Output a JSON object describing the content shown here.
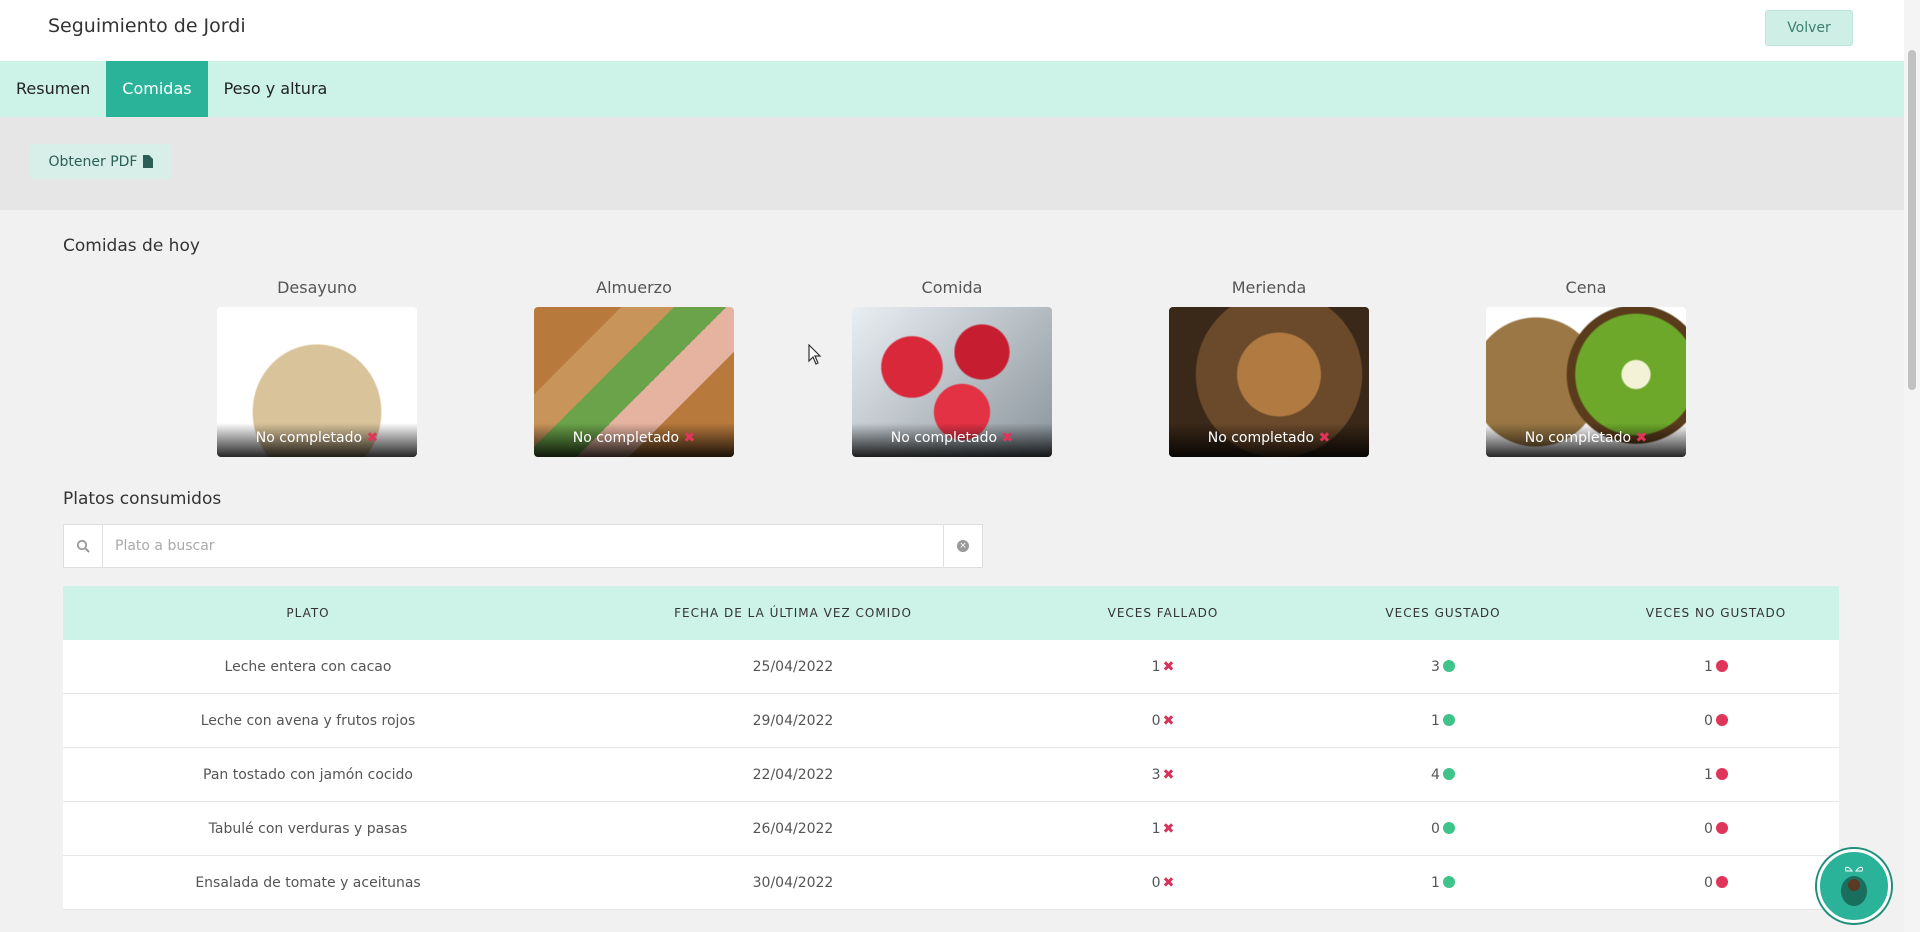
{
  "header": {
    "title": "Seguimiento de Jordi",
    "back_label": "Volver"
  },
  "tabs": [
    {
      "label": "Resumen",
      "active": false
    },
    {
      "label": "Comidas",
      "active": true
    },
    {
      "label": "Peso y altura",
      "active": false
    }
  ],
  "toolbar": {
    "pdf_label": "Obtener PDF",
    "pdf_icon": "file-pdf-icon"
  },
  "today": {
    "title": "Comidas de hoy",
    "meals": [
      {
        "label": "Desayuno",
        "status": "No completado",
        "image": "oats"
      },
      {
        "label": "Almuerzo",
        "status": "No completado",
        "image": "sandwich"
      },
      {
        "label": "Comida",
        "status": "No completado",
        "image": "strawberries"
      },
      {
        "label": "Merienda",
        "status": "No completado",
        "image": "nuts"
      },
      {
        "label": "Cena",
        "status": "No completado",
        "image": "kiwi"
      }
    ]
  },
  "dishes": {
    "title": "Platos consumidos",
    "search_placeholder": "Plato a buscar",
    "search_value": "",
    "columns": [
      "PLATO",
      "FECHA DE LA ÚLTIMA VEZ COMIDO",
      "VECES FALLADO",
      "VECES GUSTADO",
      "VECES NO GUSTADO"
    ],
    "rows": [
      {
        "plato": "Leche entera con cacao",
        "fecha": "25/04/2022",
        "fallado": "1",
        "gustado": "3",
        "no_gustado": "1"
      },
      {
        "plato": "Leche con avena y frutos rojos",
        "fecha": "29/04/2022",
        "fallado": "0",
        "gustado": "1",
        "no_gustado": "0"
      },
      {
        "plato": "Pan tostado con jamón cocido",
        "fecha": "22/04/2022",
        "fallado": "3",
        "gustado": "4",
        "no_gustado": "1"
      },
      {
        "plato": "Tabulé con verduras y pasas",
        "fecha": "26/04/2022",
        "fallado": "1",
        "gustado": "0",
        "no_gustado": "0"
      },
      {
        "plato": "Ensalada de tomate y aceitunas",
        "fecha": "30/04/2022",
        "fallado": "0",
        "gustado": "1",
        "no_gustado": "0"
      }
    ]
  },
  "colors": {
    "accent": "#2bb39a",
    "tab_bg": "#cdf2e8",
    "miss": "#d6335a",
    "like": "#3ec48a",
    "dislike": "#e0355a"
  }
}
